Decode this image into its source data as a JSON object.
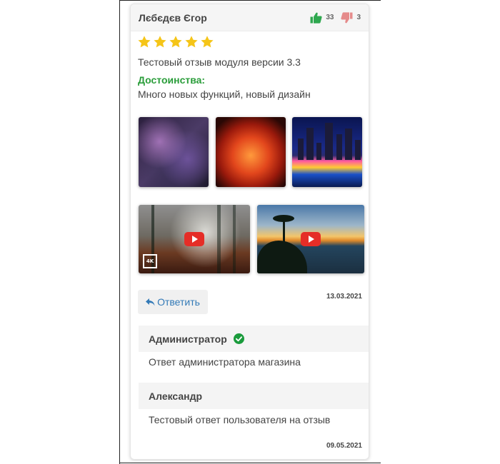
{
  "review": {
    "author": "Лєбєдєв Єгор",
    "likes": "33",
    "dislikes": "3",
    "rating": 5,
    "text": "Тестовый отзыв модуля версии 3.3",
    "pros_title": "Достоинства:",
    "pros_text": "Много новых функций, новый дизайн",
    "date": "13.03.2021",
    "reply_label": "Ответить",
    "video_badge": "4K"
  },
  "answers": [
    {
      "author": "Администратор",
      "verified": true,
      "text": "Ответ администратора магазина"
    },
    {
      "author": "Александр",
      "verified": false,
      "text": "Тестовый ответ пользователя на отзыв",
      "date": "09.05.2021"
    }
  ],
  "colors": {
    "like": "#2fa84f",
    "dislike": "#e58b8b",
    "star": "#f5c518",
    "pros": "#2a9d3a",
    "link": "#337ab7",
    "verified": "#1a9b3c"
  },
  "icons": [
    "thumbs-up-icon",
    "thumbs-down-icon",
    "star-icon",
    "reply-icon",
    "youtube-play-icon",
    "check-circle-icon"
  ]
}
